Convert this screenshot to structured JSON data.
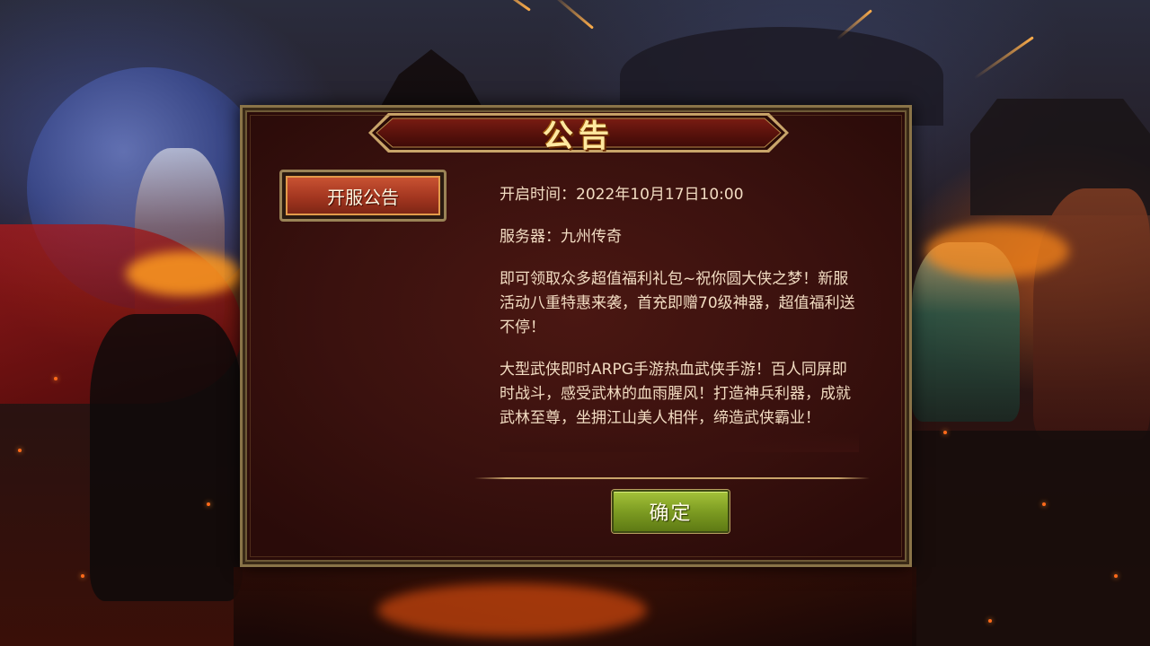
{
  "dialog": {
    "title": "公告",
    "tab_label": "开服公告",
    "open_time": "开启时间：2022年10月17日10:00",
    "server": "服务器：九州传奇",
    "paragraph_1": "即可领取众多超值福利礼包~祝你圆大侠之梦！新服活动八重特惠来袭，首充即赠70级神器，超值福利送不停！",
    "paragraph_2": "大型武侠即时ARPG手游热血武侠手游！百人同屏即时战斗，感受武林的血雨腥风！打造神兵利器，成就武林至尊，坐拥江山美人相伴，缔造武侠霸业！",
    "confirm_label": "确定"
  },
  "colors": {
    "panel": "#3a110e",
    "frame": "#8a7448",
    "tab_red": "#a33620",
    "confirm_green": "#7d9c22",
    "title_gold": "#ffe9a0"
  }
}
